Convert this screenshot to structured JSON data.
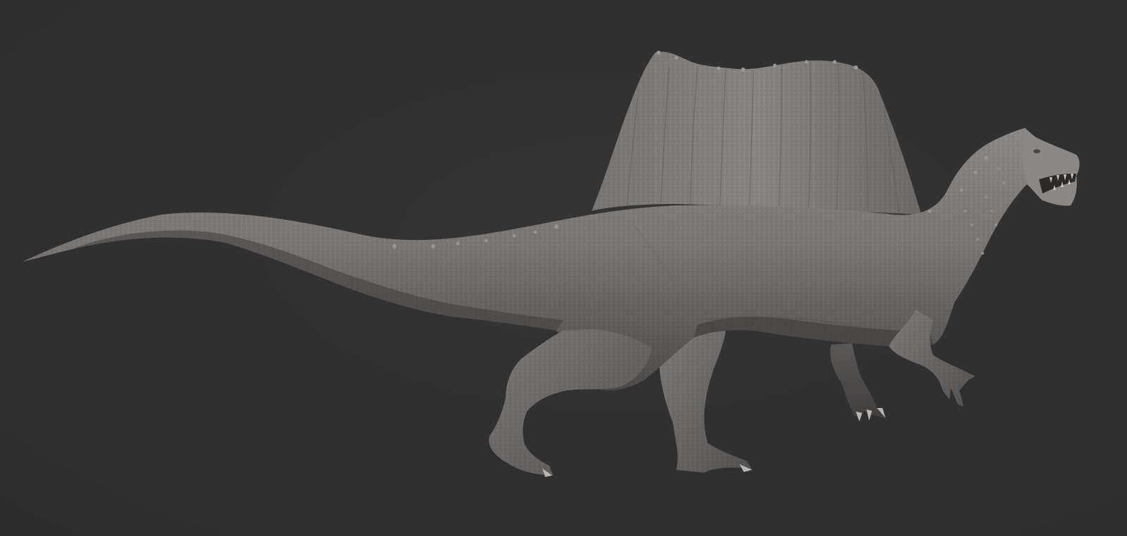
{
  "scene": {
    "subject": "spinosaurus-sculpt",
    "background_color": "#2f2f2f",
    "material_color": "#7d7a78"
  }
}
